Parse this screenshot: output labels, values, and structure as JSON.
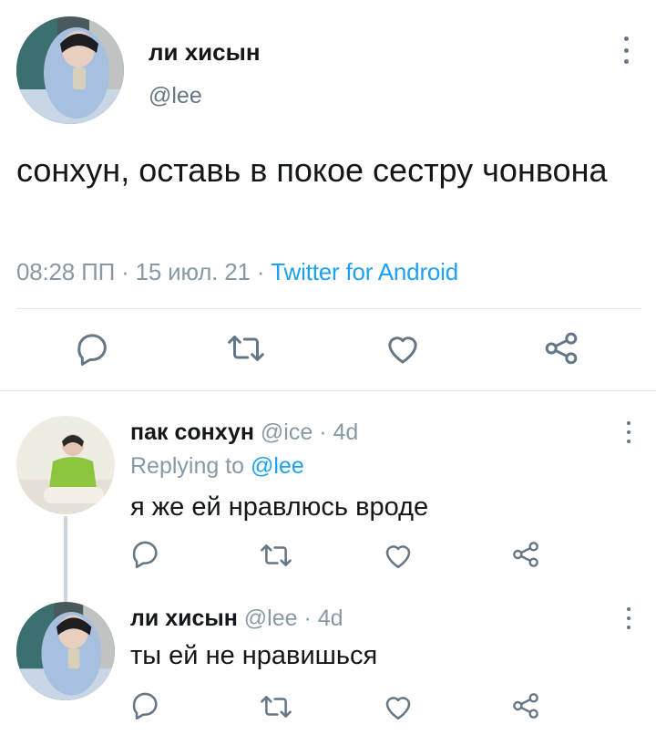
{
  "main_tweet": {
    "author_name": "ли хисын",
    "author_handle": "@lee",
    "text": "сонхун, оставь в покое сестру чонвона",
    "time": "08:28 ПП",
    "date": "15 июл. 21",
    "source": "Twitter for Android",
    "separator": "·"
  },
  "replies": [
    {
      "author_name": "пак сонхун",
      "author_handle": "@ice",
      "age": "4d",
      "replying_prefix": "Replying to",
      "replying_handle": "@lee",
      "text": "я же ей нравлюсь вроде"
    },
    {
      "author_name": "ли хисын",
      "author_handle": "@lee",
      "age": "4d",
      "text": "ты ей не нравишься"
    }
  ],
  "icons": [
    "reply-icon",
    "retweet-icon",
    "like-icon",
    "share-icon",
    "more-icon"
  ],
  "colors": {
    "link": "#1da1f2",
    "muted": "#657786",
    "divider": "#e1e8ed",
    "thread": "#ccd6dd"
  }
}
